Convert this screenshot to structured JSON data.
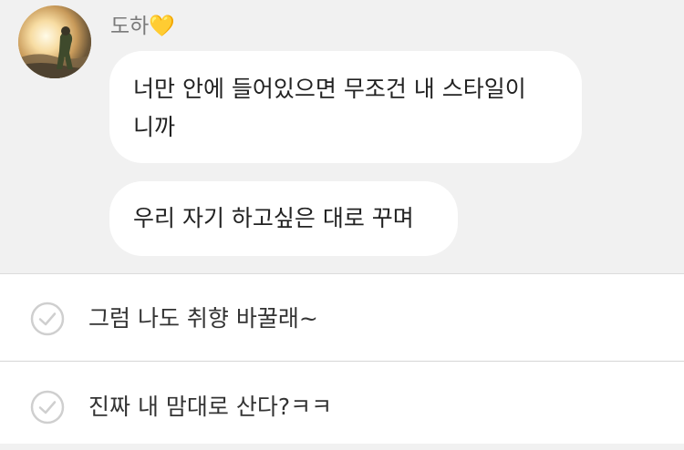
{
  "chat": {
    "sender_name": "도하💛",
    "messages": [
      {
        "line1": "너만 안에 들어있으면 무조건 내 스타일이",
        "line2": "니까"
      },
      {
        "line1": "우리 자기 하고싶은 대로 꾸며"
      }
    ]
  },
  "replies": {
    "options": [
      {
        "label": "그럼 나도 취향 바꿀래~",
        "icon": "check-circle-icon"
      },
      {
        "label": "진짜 내 맘대로 산다?ㅋㅋ",
        "icon": "check-circle-icon"
      }
    ]
  },
  "colors": {
    "chat_background": "#f1f1f1",
    "bubble": "#ffffff",
    "panel": "#ffffff",
    "check": "#cfcfcf"
  }
}
